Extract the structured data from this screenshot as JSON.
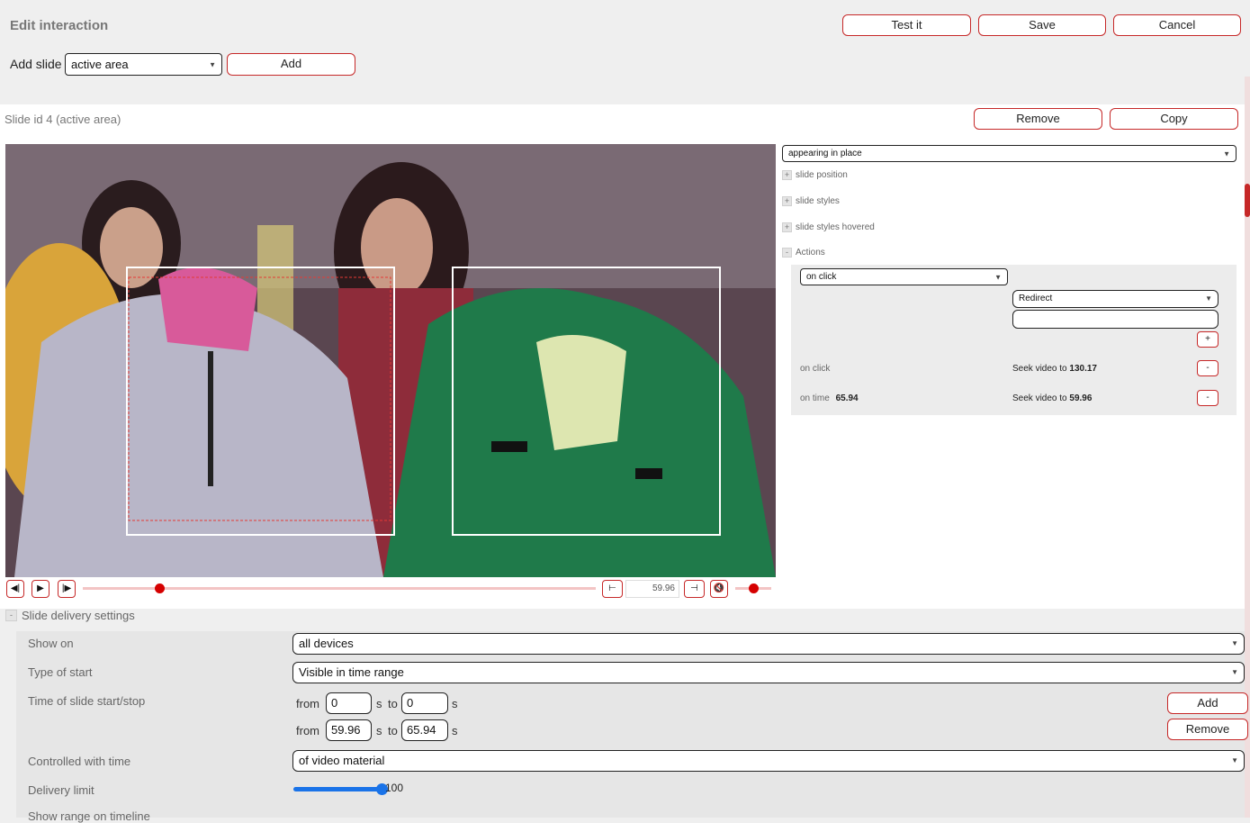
{
  "header": {
    "title": "Edit interaction",
    "test_label": "Test it",
    "save_label": "Save",
    "cancel_label": "Cancel"
  },
  "add_slide": {
    "label": "Add slide",
    "select_value": "active area",
    "add_label": "Add"
  },
  "slide": {
    "title": "Slide id 4 (active area)",
    "remove_label": "Remove",
    "copy_label": "Copy"
  },
  "side_panel": {
    "appearance_value": "appearing in place",
    "sections": [
      "slide position",
      "slide styles",
      "slide styles hovered"
    ],
    "actions_label": "Actions",
    "trigger_value": "on click",
    "action_value": "Redirect",
    "redirect_value": "",
    "plus_label": "+",
    "minus_label": "-",
    "rows": [
      {
        "trigger": "on click",
        "time": "",
        "action_prefix": "Seek video to",
        "action_value": "130.17"
      },
      {
        "trigger": "on time",
        "time": "65.94",
        "action_prefix": "Seek video to",
        "action_value": "59.96"
      }
    ]
  },
  "player": {
    "time_value": "59.96",
    "progress": 0.15,
    "volume": 0.5
  },
  "delivery": {
    "toggle": "-",
    "title": "Slide delivery settings",
    "show_on_label": "Show on",
    "show_on_value": "all devices",
    "type_start_label": "Type of start",
    "type_start_value": "Visible in time range",
    "time_label": "Time of slide start/stop",
    "from_label": "from",
    "to_label": "to",
    "s_label": "s",
    "ranges": [
      {
        "from": "0",
        "to": "0"
      },
      {
        "from": "59.96",
        "to": "65.94"
      }
    ],
    "add_label": "Add",
    "remove_label": "Remove",
    "controlled_label": "Controlled with time",
    "controlled_value": "of video material",
    "limit_label": "Delivery limit",
    "limit_value": "100",
    "limit_fraction": 1.0,
    "cut_label": "Show range on timeline"
  },
  "colors": {
    "accent": "#c62828",
    "slider": "#1a73e8"
  }
}
